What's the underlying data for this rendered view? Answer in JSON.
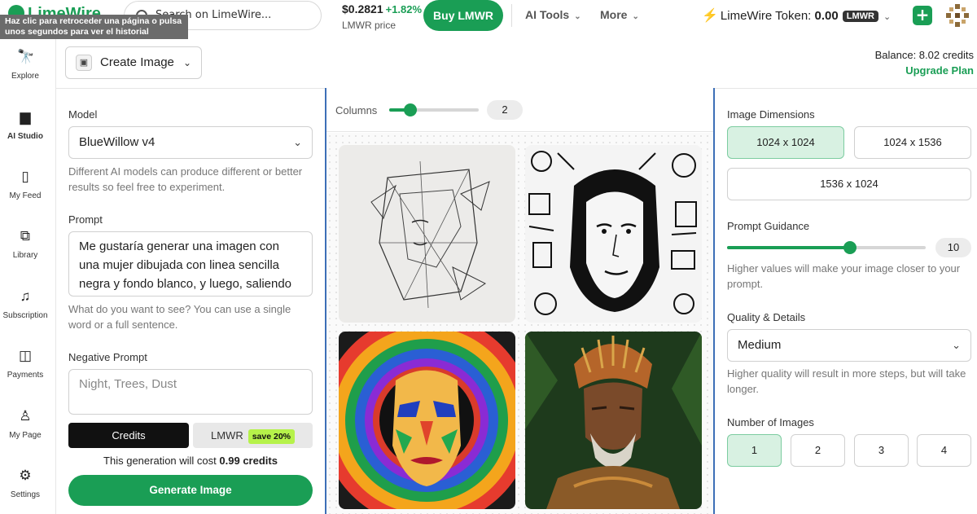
{
  "topbar": {
    "logo_text": "LimeWire",
    "tooltip": "Haz clic para retroceder una página o pulsa unos segundos para ver el historial",
    "search_placeholder": "Search on LimeWire...",
    "price_value": "$0.2821",
    "price_change": "+1.82%",
    "price_label": "LMWR price",
    "buy_label": "Buy LMWR",
    "menu_ai_tools": "AI Tools",
    "menu_more": "More",
    "token_label": "LimeWire Token:",
    "token_amount": "0.00",
    "token_currency": "LMWR",
    "plus_label": "+"
  },
  "leftnav": {
    "items": [
      {
        "label": "Explore",
        "icon": "telescope-icon",
        "glyph": "🔭"
      },
      {
        "label": "AI Studio",
        "icon": "monitor-icon",
        "glyph": "▆"
      },
      {
        "label": "My Feed",
        "icon": "feed-icon",
        "glyph": "▯"
      },
      {
        "label": "Library",
        "icon": "library-icon",
        "glyph": "⧉"
      },
      {
        "label": "Subscription",
        "icon": "music-icon",
        "glyph": "♫"
      },
      {
        "label": "Payments",
        "icon": "wallet-icon",
        "glyph": "◫"
      },
      {
        "label": "My Page",
        "icon": "user-icon",
        "glyph": "♙"
      },
      {
        "label": "Settings",
        "icon": "gear-icon",
        "glyph": "⚙"
      }
    ]
  },
  "header": {
    "create_label": "Create Image",
    "balance": "Balance: 8.02 credits",
    "upgrade": "Upgrade Plan"
  },
  "form": {
    "model_label": "Model",
    "model_value": "BlueWillow v4",
    "model_help": "Different AI models can produce different or better results so feel free to experiment.",
    "prompt_label": "Prompt",
    "prompt_value": "Me gustaría generar una imagen con una mujer dibujada con linea sencilla negra y fondo blanco, y luego, saliendo",
    "prompt_help": "What do you want to see? You can use a single word or a full sentence.",
    "negative_label": "Negative Prompt",
    "negative_placeholder": "Night, Trees, Dust",
    "pay_credits": "Credits",
    "pay_lmwr": "LMWR",
    "pay_badge": "save 20%",
    "cost_text": "This generation will cost",
    "cost_value": "0.99 credits",
    "generate_label": "Generate Image"
  },
  "gallery": {
    "columns_label": "Columns",
    "columns_value": "2",
    "columns_fraction": 0.24,
    "images": [
      {
        "name": "line-art-woman-image"
      },
      {
        "name": "doodle-woman-image"
      },
      {
        "name": "psychedelic-face-image"
      },
      {
        "name": "tribal-elder-image"
      }
    ]
  },
  "settings": {
    "dimensions_label": "Image Dimensions",
    "dimensions": [
      "1024 x 1024",
      "1024 x 1536",
      "1536 x 1024"
    ],
    "dimensions_selected": "1024 x 1024",
    "guidance_label": "Prompt Guidance",
    "guidance_value": "10",
    "guidance_fraction": 0.62,
    "guidance_help": "Higher values will make your image closer to your prompt.",
    "quality_label": "Quality & Details",
    "quality_value": "Medium",
    "quality_help": "Higher quality will result in more steps, but will take longer.",
    "count_label": "Number of Images",
    "counts": [
      "1",
      "2",
      "3",
      "4"
    ],
    "count_selected": "1"
  },
  "colors": {
    "accent": "#1a9e55",
    "selected_bg": "#d8f1e2",
    "gallery_border": "#3d6fb7"
  }
}
